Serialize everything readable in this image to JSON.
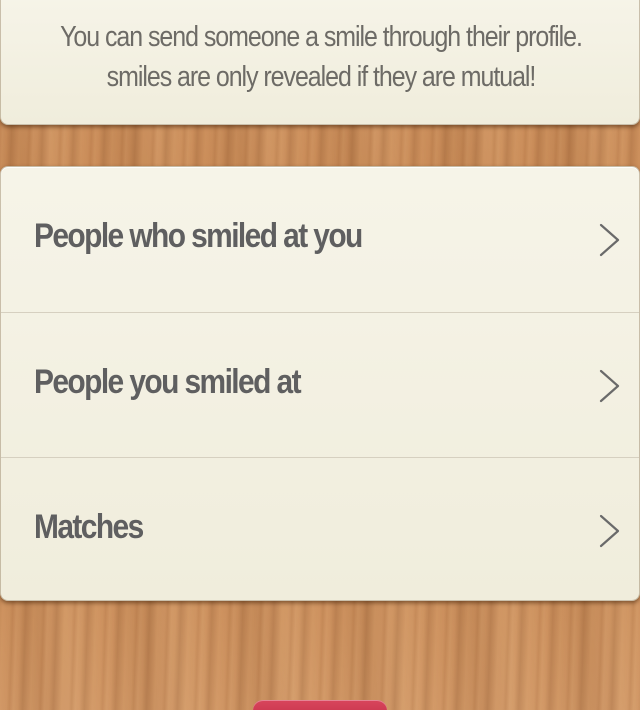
{
  "info": {
    "line1": "You can send someone a smile through their profile.",
    "line2": "smiles are only revealed if they are mutual!"
  },
  "menu": {
    "items": [
      {
        "label": "People who smiled at you",
        "icon": "chevron-right-icon"
      },
      {
        "label": "People you smiled at",
        "icon": "chevron-right-icon"
      },
      {
        "label": "Matches",
        "icon": "chevron-right-icon"
      }
    ]
  },
  "colors": {
    "card": "#f2efdf",
    "text": "#5f5f60",
    "wood": "#c98a55",
    "button": "#c93450"
  }
}
